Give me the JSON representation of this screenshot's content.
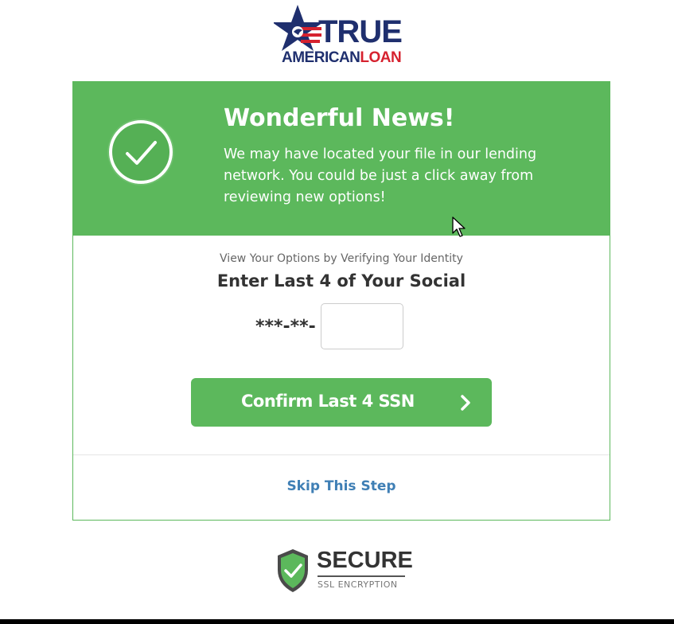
{
  "logo": {
    "word_true": "TRUE",
    "word_american": "AMERICAN",
    "word_loan": "LOAN",
    "icon": "star-stripes-logo-icon"
  },
  "banner": {
    "icon": "check-circle-icon",
    "title": "Wonderful News!",
    "message": "We may have located your file in our lending network. You could be just a click away from reviewing new options!"
  },
  "verify": {
    "label": "View Your Options by Verifying Your Identity",
    "heading": "Enter Last 4 of Your Social",
    "ssn_mask": "***-**-",
    "ssn_value": ""
  },
  "confirm": {
    "label": "Confirm Last 4 SSN",
    "icon": "chevron-right-icon"
  },
  "skip": {
    "label": "Skip This Step"
  },
  "secure": {
    "icon": "shield-check-icon",
    "title": "SECURE",
    "subtitle": "SSL ENCRYPTION"
  },
  "colors": {
    "brand_green": "#5cb85c",
    "navy": "#1f2f6e",
    "red": "#d6222f",
    "link_blue": "#3f7fb5"
  }
}
